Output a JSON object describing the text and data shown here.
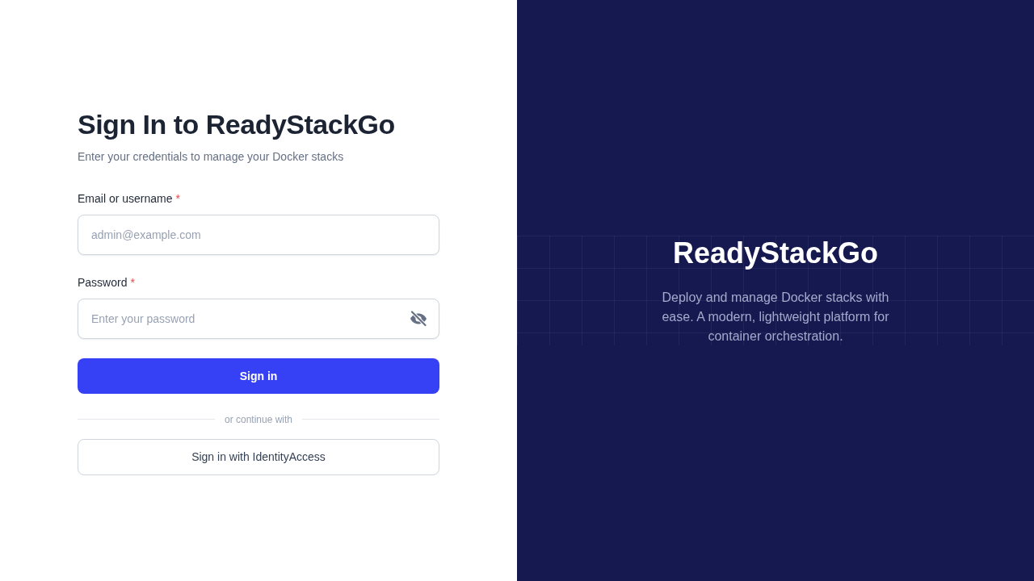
{
  "sign_in": {
    "title": "Sign In to ReadyStackGo",
    "subtitle": "Enter your credentials to manage your Docker stacks",
    "fields": [
      {
        "kind": "text",
        "label": "Email or username",
        "required_mark": "*",
        "placeholder": "admin@example.com"
      },
      {
        "kind": "password",
        "label": "Password",
        "required_mark": "*",
        "placeholder": "Enter your password"
      }
    ],
    "submit_button": "Sign in",
    "divider": "or continue with",
    "sso_button": "Sign in with IdentityAccess"
  },
  "brand_panel": {
    "title": "ReadyStackGo",
    "description": "Deploy and manage Docker stacks with ease. A modern, lightweight platform for container orchestration."
  }
}
